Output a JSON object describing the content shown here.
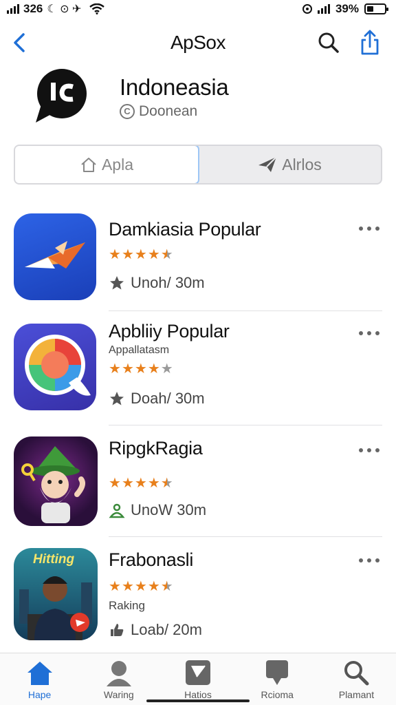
{
  "status_bar": {
    "time": "326",
    "icons_left": "☾ ⊙ ✈",
    "battery_percent": "39%",
    "battery_level": 0.39
  },
  "nav": {
    "title": "ApSox"
  },
  "profile": {
    "name": "Indoneasia",
    "subtitle": "Doonean",
    "copyright_symbol": "C"
  },
  "segment": {
    "tabs": [
      {
        "label": "Apla",
        "icon": "home-icon",
        "active": true
      },
      {
        "label": "Alrlos",
        "icon": "paper-plane-icon",
        "active": false
      }
    ]
  },
  "apps": [
    {
      "title": "Damkiasia Popular",
      "subtitle": "",
      "rating": 4.5,
      "meta_icon": "star-icon",
      "meta": "Unoh/ 30m"
    },
    {
      "title": "Apbliiy Popular",
      "subtitle": "Appallatasm",
      "rating": 4,
      "meta_icon": "star-icon",
      "meta": "Doah/ 30m"
    },
    {
      "title": "RipgkRagia",
      "subtitle": "",
      "rating": 4.5,
      "meta_icon": "person-icon",
      "meta": "UnoW 30m"
    },
    {
      "title": "Frabonasli",
      "subtitle": "Raking",
      "rating": 4.5,
      "meta_icon": "thumb-icon",
      "meta": "Loab/ 20m",
      "icon_text": "Hitting"
    }
  ],
  "tabbar": {
    "tabs": [
      {
        "label": "Hape",
        "icon": "home-icon",
        "active": true
      },
      {
        "label": "Waring",
        "icon": "user-icon",
        "active": false
      },
      {
        "label": "Hatios",
        "icon": "apps-icon",
        "active": false
      },
      {
        "label": "Rcioma",
        "icon": "chat-icon",
        "active": false
      },
      {
        "label": "Plamant",
        "icon": "search-icon",
        "active": false
      }
    ]
  },
  "colors": {
    "accent": "#1f6fd6",
    "star": "#e8801c"
  }
}
